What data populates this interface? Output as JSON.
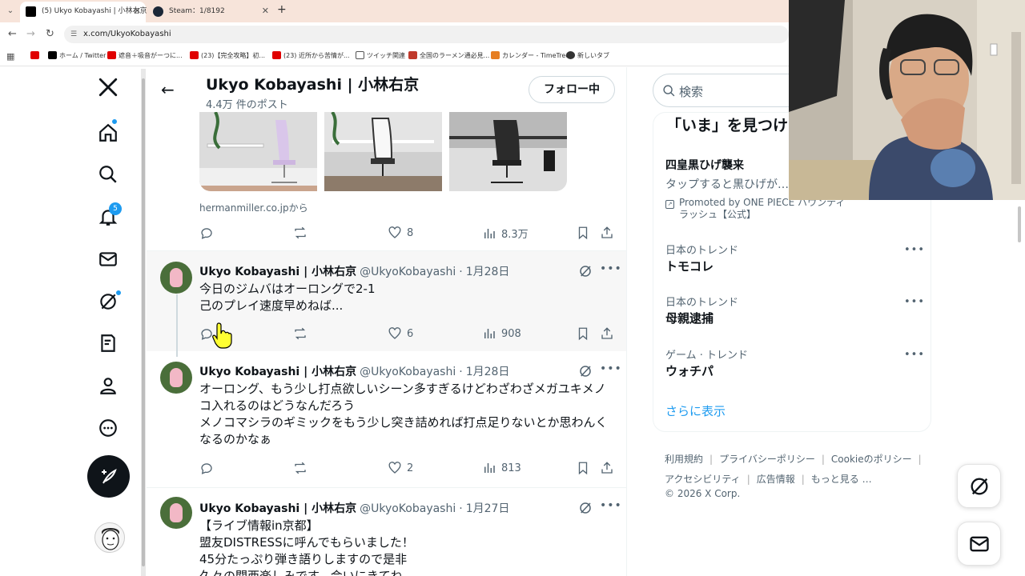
{
  "browser": {
    "tabs": [
      {
        "title": "(5) Ukyo Kobayashi | 小林右京",
        "active": true
      },
      {
        "title": "Steam：1/8192",
        "active": false
      }
    ],
    "url": "x.com/UkyoKobayashi",
    "bookmarks": [
      {
        "label": "ホーム / Twitter",
        "icon_color": "#000000"
      },
      {
        "label": "遮音＋吸音がーつに...",
        "icon_color": "#e00000"
      },
      {
        "label": "(23)【完全攻略】初...",
        "icon_color": "#e00000"
      },
      {
        "label": "(23) 近所から苦情が...",
        "icon_color": "#e00000"
      },
      {
        "label": "ツイッチ関連",
        "icon_color": "#555555"
      },
      {
        "label": "全国のラーメン通必見...",
        "icon_color": "#c0392b"
      },
      {
        "label": "カレンダー - TimeTree",
        "icon_color": "#e67e22"
      },
      {
        "label": "新しいタブ",
        "icon_color": "#333333"
      }
    ]
  },
  "nav": {
    "notification_count": "5",
    "icons": [
      "x-logo-icon",
      "home-icon",
      "search-icon",
      "bell-icon",
      "mail-icon",
      "grok-icon",
      "lists-icon",
      "profile-icon",
      "more-icon",
      "post-icon"
    ]
  },
  "header": {
    "name": "Ukyo Kobayashi | 小林右京",
    "post_count": "4.4万 件のポスト",
    "follow_label": "フォロー中"
  },
  "card": {
    "source": "hermanmiller.co.jpから",
    "stats": {
      "reply": "",
      "retweet": "",
      "like": "8",
      "views": "8.3万"
    }
  },
  "tweets": [
    {
      "name": "Ukyo Kobayashi | 小林右京",
      "handle": "@UkyoKobayashi",
      "date": "1月28日",
      "text": "今日のジムバはオーロングで2-1\n己のプレイ速度早めねば...",
      "reply": "",
      "retweet": "",
      "like": "6",
      "views": "908"
    },
    {
      "name": "Ukyo Kobayashi | 小林右京",
      "handle": "@UkyoKobayashi",
      "date": "1月28日",
      "text": "オーロング、もう少し打点欲しいシーン多すぎるけどわざわざメガユキメノコ入れるのはどうなんだろう\nメノコマシラのギミックをもう少し突き詰めれば打点足りないとか思わんくなるのかなぁ",
      "reply": "",
      "retweet": "",
      "like": "2",
      "views": "813"
    },
    {
      "name": "Ukyo Kobayashi | 小林右京",
      "handle": "@UkyoKobayashi",
      "date": "1月27日",
      "text": "【ライブ情報in京都】\n盟友DISTRESSに呼んでもらいました！\n45分たっぷり弾き語りしますので是非\n久々の関西楽しみです、会いにきてね"
    }
  ],
  "sidebar": {
    "search_placeholder": "検索",
    "trends_title": "「いま」を見つけよう",
    "promoted": {
      "title": "四皇黒ひげ襲来",
      "desc": "タップすると黒ひげが…",
      "by": "Promoted by ONE PIECE バウンティラッシュ【公式】"
    },
    "trends": [
      {
        "category": "日本のトレンド",
        "name": "トモコレ"
      },
      {
        "category": "日本のトレンド",
        "name": "母親逮捕"
      },
      {
        "category": "ゲーム · トレンド",
        "name": "ウォチパ"
      }
    ],
    "show_more": "さらに表示",
    "footer_links": [
      "利用規約",
      "プライバシーポリシー",
      "Cookieのポリシー",
      "アクセシビリティ",
      "広告情報",
      "もっと見る …"
    ],
    "copyright": "© 2026 X Corp."
  },
  "colors": {
    "accent": "#1d9bf0",
    "text": "#0f1419",
    "muted": "#536471",
    "tab_bar": "#f7e4da"
  }
}
